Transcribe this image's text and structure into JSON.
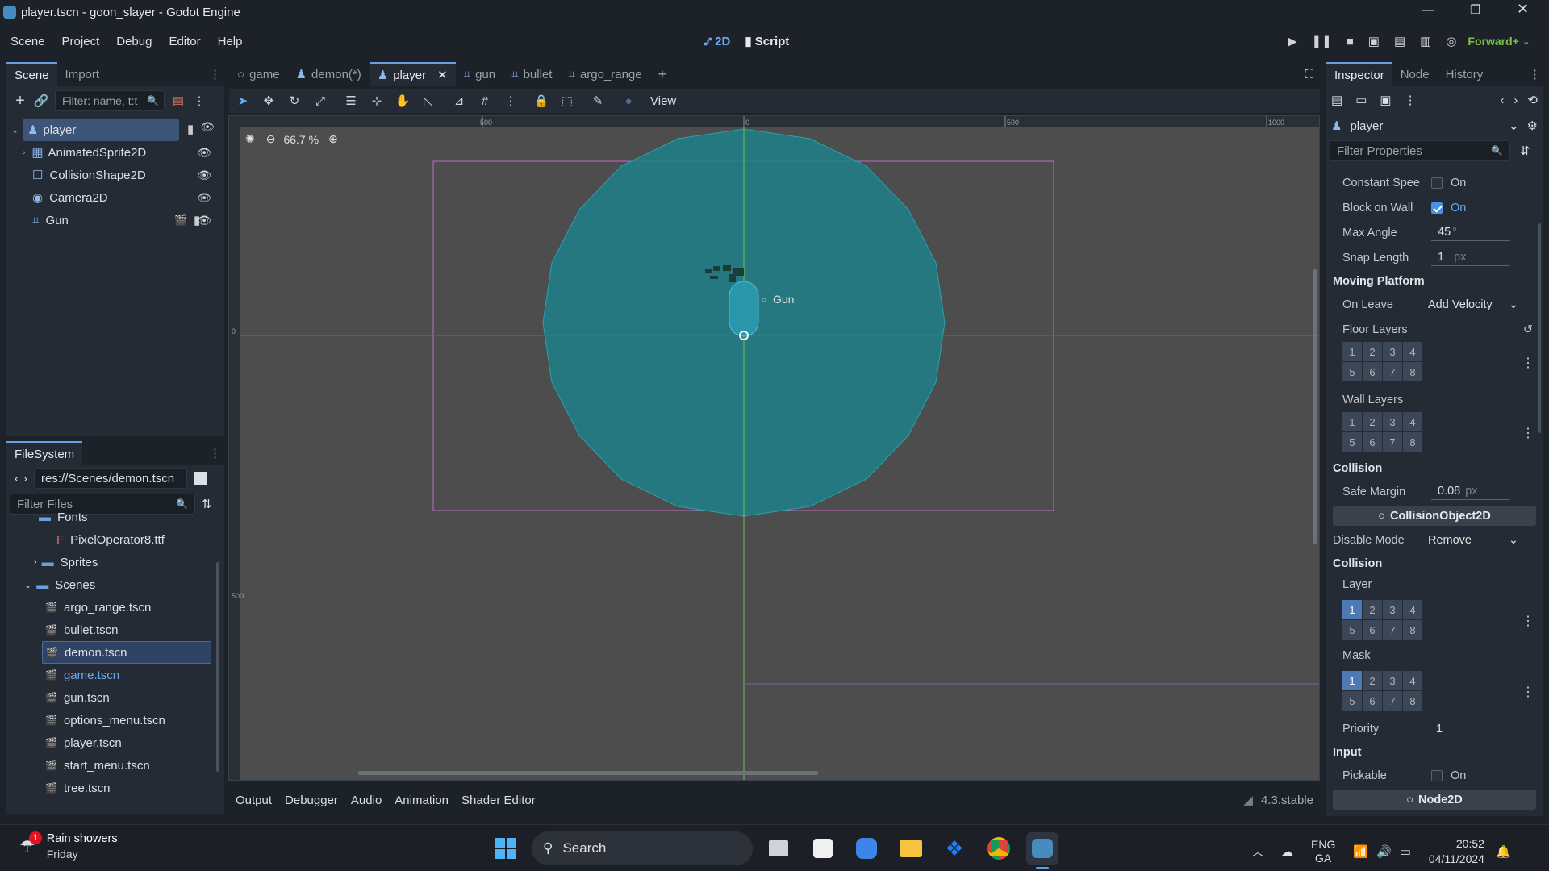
{
  "window": {
    "title": "player.tscn - goon_slayer - Godot Engine"
  },
  "menu": [
    "Scene",
    "Project",
    "Debug",
    "Editor",
    "Help"
  ],
  "workspace": {
    "mode_2d": "2D",
    "mode_script": "Script",
    "renderer": "Forward+"
  },
  "scene_dock": {
    "tabs": [
      "Scene",
      "Import"
    ],
    "filter_placeholder": "Filter: name, t:t",
    "nodes": [
      {
        "name": "player",
        "icon": "character-body-icon"
      },
      {
        "name": "AnimatedSprite2D",
        "icon": "animated-sprite-icon"
      },
      {
        "name": "CollisionShape2D",
        "icon": "collision-shape-icon"
      },
      {
        "name": "Camera2D",
        "icon": "camera-icon"
      },
      {
        "name": "Gun",
        "icon": "area2d-icon"
      }
    ]
  },
  "filesystem": {
    "tab": "FileSystem",
    "path": "res://Scenes/demon.tscn",
    "filter_placeholder": "Filter Files",
    "items": [
      {
        "name": "Fonts",
        "type": "folder"
      },
      {
        "name": "PixelOperator8.ttf",
        "type": "font"
      },
      {
        "name": "Sprites",
        "type": "folder"
      },
      {
        "name": "Scenes",
        "type": "folder"
      },
      {
        "name": "argo_range.tscn",
        "type": "scene"
      },
      {
        "name": "bullet.tscn",
        "type": "scene"
      },
      {
        "name": "demon.tscn",
        "type": "scene"
      },
      {
        "name": "game.tscn",
        "type": "scene"
      },
      {
        "name": "gun.tscn",
        "type": "scene"
      },
      {
        "name": "options_menu.tscn",
        "type": "scene"
      },
      {
        "name": "player.tscn",
        "type": "scene"
      },
      {
        "name": "start_menu.tscn",
        "type": "scene"
      },
      {
        "name": "tree.tscn",
        "type": "scene"
      }
    ]
  },
  "editor_tabs": [
    "game",
    "demon(*)",
    "player",
    "gun",
    "bullet",
    "argo_range"
  ],
  "toolbar": {
    "view_label": "View",
    "zoom": "66.7 %"
  },
  "ruler": {
    "h_labels": [
      "-500",
      "0",
      "500",
      "1000"
    ],
    "v_labels": [
      "0",
      "500"
    ]
  },
  "viewport": {
    "gun_label": "Gun"
  },
  "bottom_tabs": [
    "Output",
    "Debugger",
    "Audio",
    "Animation",
    "Shader Editor"
  ],
  "version": "4.3.stable",
  "inspector": {
    "tabs": [
      "Inspector",
      "Node",
      "History"
    ],
    "node": "player",
    "filter_placeholder": "Filter Properties",
    "constant_speed": {
      "label": "Constant Spee",
      "value": "On"
    },
    "block_on_wall": {
      "label": "Block on Wall",
      "value": "On"
    },
    "max_angle": {
      "label": "Max Angle",
      "value": "45",
      "unit": "°"
    },
    "snap_length": {
      "label": "Snap Length",
      "value": "1",
      "unit": "px"
    },
    "moving_platform": "Moving Platform",
    "on_leave": {
      "label": "On Leave",
      "value": "Add Velocity"
    },
    "floor_layers": "Floor Layers",
    "wall_layers": "Wall Layers",
    "collision_section": "Collision",
    "safe_margin": {
      "label": "Safe Margin",
      "value": "0.08",
      "unit": "px"
    },
    "collision_object": "CollisionObject2D",
    "disable_mode": {
      "label": "Disable Mode",
      "value": "Remove"
    },
    "collision_section2": "Collision",
    "layer": "Layer",
    "mask": "Mask",
    "priority": {
      "label": "Priority",
      "value": "1"
    },
    "input_section": "Input",
    "pickable": {
      "label": "Pickable",
      "value": "On"
    },
    "node2d": "Node2D",
    "layer_numbers": [
      "1",
      "2",
      "3",
      "4",
      "5",
      "6",
      "7",
      "8"
    ]
  },
  "taskbar": {
    "weather_title": "Rain showers",
    "weather_sub": "Friday",
    "badge": "1",
    "search": "Search",
    "lang1": "ENG",
    "lang2": "GA",
    "time": "20:52",
    "date": "04/11/2024"
  }
}
